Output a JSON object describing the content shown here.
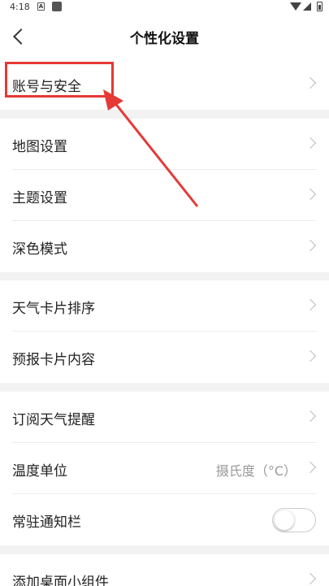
{
  "status_bar": {
    "time": "4:18",
    "notification_icon_letter": "A"
  },
  "header": {
    "title": "个性化设置"
  },
  "groups": [
    {
      "items": [
        {
          "label": "账号与安全"
        }
      ]
    },
    {
      "items": [
        {
          "label": "地图设置"
        },
        {
          "label": "主题设置"
        },
        {
          "label": "深色模式"
        }
      ]
    },
    {
      "items": [
        {
          "label": "天气卡片排序"
        },
        {
          "label": "预报卡片内容"
        }
      ]
    },
    {
      "items": [
        {
          "label": "订阅天气提醒"
        },
        {
          "label": "温度单位",
          "value": "摄氏度（°C）"
        },
        {
          "label": "常驻通知栏",
          "toggle": false
        }
      ]
    },
    {
      "items": [
        {
          "label": "添加桌面小组件"
        }
      ]
    }
  ],
  "colors": {
    "highlight": "#e53935",
    "background": "#f2f2f2"
  }
}
